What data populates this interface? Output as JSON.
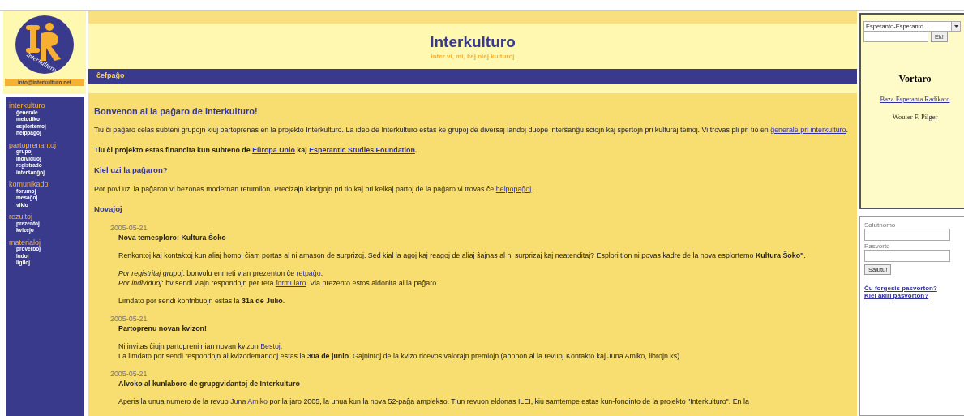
{
  "logo": {
    "text": "Interkulturo"
  },
  "email": "info@interkulturo.net",
  "header": {
    "title": "Interkulturo",
    "subtitle": "inter vi, mi, kaj niaj kulturoj"
  },
  "breadcrumb": "ĉefpaĝo",
  "nav": [
    {
      "heading": "interkulturo",
      "items": [
        "ĝenerale",
        "metodiko",
        "esplortemoj",
        "helppaĝoj"
      ]
    },
    {
      "heading": "partoprenantoj",
      "items": [
        "grupoj",
        "individuoj",
        "registrado",
        "interŝanĝoj"
      ]
    },
    {
      "heading": "komunikado",
      "items": [
        "forumoj",
        "mesaĝoj",
        "vikio"
      ]
    },
    {
      "heading": "rezultoj",
      "items": [
        "prezentoj",
        "kvizejo"
      ]
    },
    {
      "heading": "materialoj",
      "items": [
        "proverboj",
        "ludoj",
        "ligiloj"
      ]
    }
  ],
  "content": [
    {
      "kind": "heading",
      "text": "Bonvenon al la paĝaro de Interkulturo!"
    },
    {
      "kind": "paragraph",
      "segments": [
        {
          "kind": "text",
          "text": "Tiu ĉi paĝaro celas subteni grupojn kiuj partoprenas en la projekto Interkulturo. La ideo de Interkulturo estas ke grupoj de diversaj landoj duope interŝanĝu sciojn kaj spertojn pri kulturaj temoj. Vi trovas pli pri tio en "
        },
        {
          "kind": "link",
          "text": "ĝenerale pri interkulturo"
        },
        {
          "kind": "text",
          "text": "."
        }
      ]
    },
    {
      "kind": "strong",
      "segments": [
        {
          "kind": "text",
          "text": "Tiu ĉi projekto estas financita kun subteno de "
        },
        {
          "kind": "link",
          "text": "Eŭropa Unio"
        },
        {
          "kind": "text",
          "text": " kaj "
        },
        {
          "kind": "link",
          "text": "Esperantic Studies Foundation"
        },
        {
          "kind": "text",
          "text": "."
        }
      ]
    },
    {
      "kind": "subheading",
      "text": "Kiel uzi la paĝaron?"
    },
    {
      "kind": "paragraph",
      "segments": [
        {
          "kind": "text",
          "text": "Por povi uzi la paĝaron vi bezonas modernan retumilon. Precizajn klarigojn pri tio kaj pri kelkaj partoj de la paĝaro vi trovas ĉe "
        },
        {
          "kind": "link",
          "text": "helpopaĝoj"
        },
        {
          "kind": "text",
          "text": "."
        }
      ]
    },
    {
      "kind": "subheading",
      "text": "Novajoj"
    }
  ],
  "news": [
    {
      "date": "2005-05-21",
      "title": "Nova temesploro: Kultura Ŝoko",
      "paragraphs": [
        [
          {
            "kind": "text",
            "text": "Renkontoj kaj kontaktoj kun aliaj homoj ĉiam portas al ni amason de surprizoj. Sed kial la agoj kaj reagoj de aliaj ŝajnas al ni surprizaj kaj neatenditaj? Esplori tion ni povas kadre de la nova esplortemo **Kultura Ŝoko\"**."
          }
        ],
        [
          {
            "kind": "text",
            "text": "*Por registritaj grupoj*: bonvolu enmeti vian prezenton ĉe "
          },
          {
            "kind": "link",
            "text": "retpaĝo"
          },
          {
            "kind": "text",
            "text": "."
          },
          {
            "kind": "break"
          },
          {
            "kind": "text",
            "text": "*Por individuoj*: bv sendi viajn respondojn per reta "
          },
          {
            "kind": "link",
            "text": "formularo"
          },
          {
            "kind": "text",
            "text": ". Via prezento estos aldonita al la paĝaro."
          }
        ],
        [
          {
            "kind": "text",
            "text": "Limdato por sendi kontribuojn estas la **31a de Julio**."
          }
        ]
      ]
    },
    {
      "date": "2005-05-21",
      "title": "Partoprenu novan kvizon!",
      "paragraphs": [
        [
          {
            "kind": "text",
            "text": "Ni invitas ĉiujn partopreni nian novan kvizon "
          },
          {
            "kind": "link",
            "text": "Bestoj"
          },
          {
            "kind": "text",
            "text": "."
          },
          {
            "kind": "break"
          },
          {
            "kind": "text",
            "text": "La limdato por sendi respondojn al kvizodemandoj estas la **30a de junio**. Gajnintoj de la kvizo ricevos valorajn premiojn (abonon al la revuoj Kontakto kaj Juna Amiko, librojn ks)."
          }
        ]
      ]
    },
    {
      "date": "2005-05-21",
      "title": "Alvoko al kunlaboro de grupgvidantoj de Interkulturo",
      "paragraphs": [
        [
          {
            "kind": "text",
            "text": "Aperis la unua numero de la revuo "
          },
          {
            "kind": "link",
            "text": "Juna Amiko"
          },
          {
            "kind": "text",
            "text": " por la jaro 2005, la unua kun la nova 52-paĝa amplekso. Tiun revuon eldonas ILEI, kiu samtempe estas kun-fondinto de la projekto \"Interkulturo\". En la"
          }
        ]
      ]
    }
  ],
  "dictionary": {
    "language": "Esperanto-Esperanto",
    "button": "Ek!",
    "title": "Vortaro",
    "link": "Baza Esperanta Radikaro",
    "author": "Wouter F. Pilger"
  },
  "login": {
    "username_label": "Salutnomo",
    "password_label": "Pasvorto",
    "button": "Salutu!",
    "links": [
      "Ĉu forgesis pasvorton?",
      "Kiel akiri pasvorton?"
    ]
  }
}
